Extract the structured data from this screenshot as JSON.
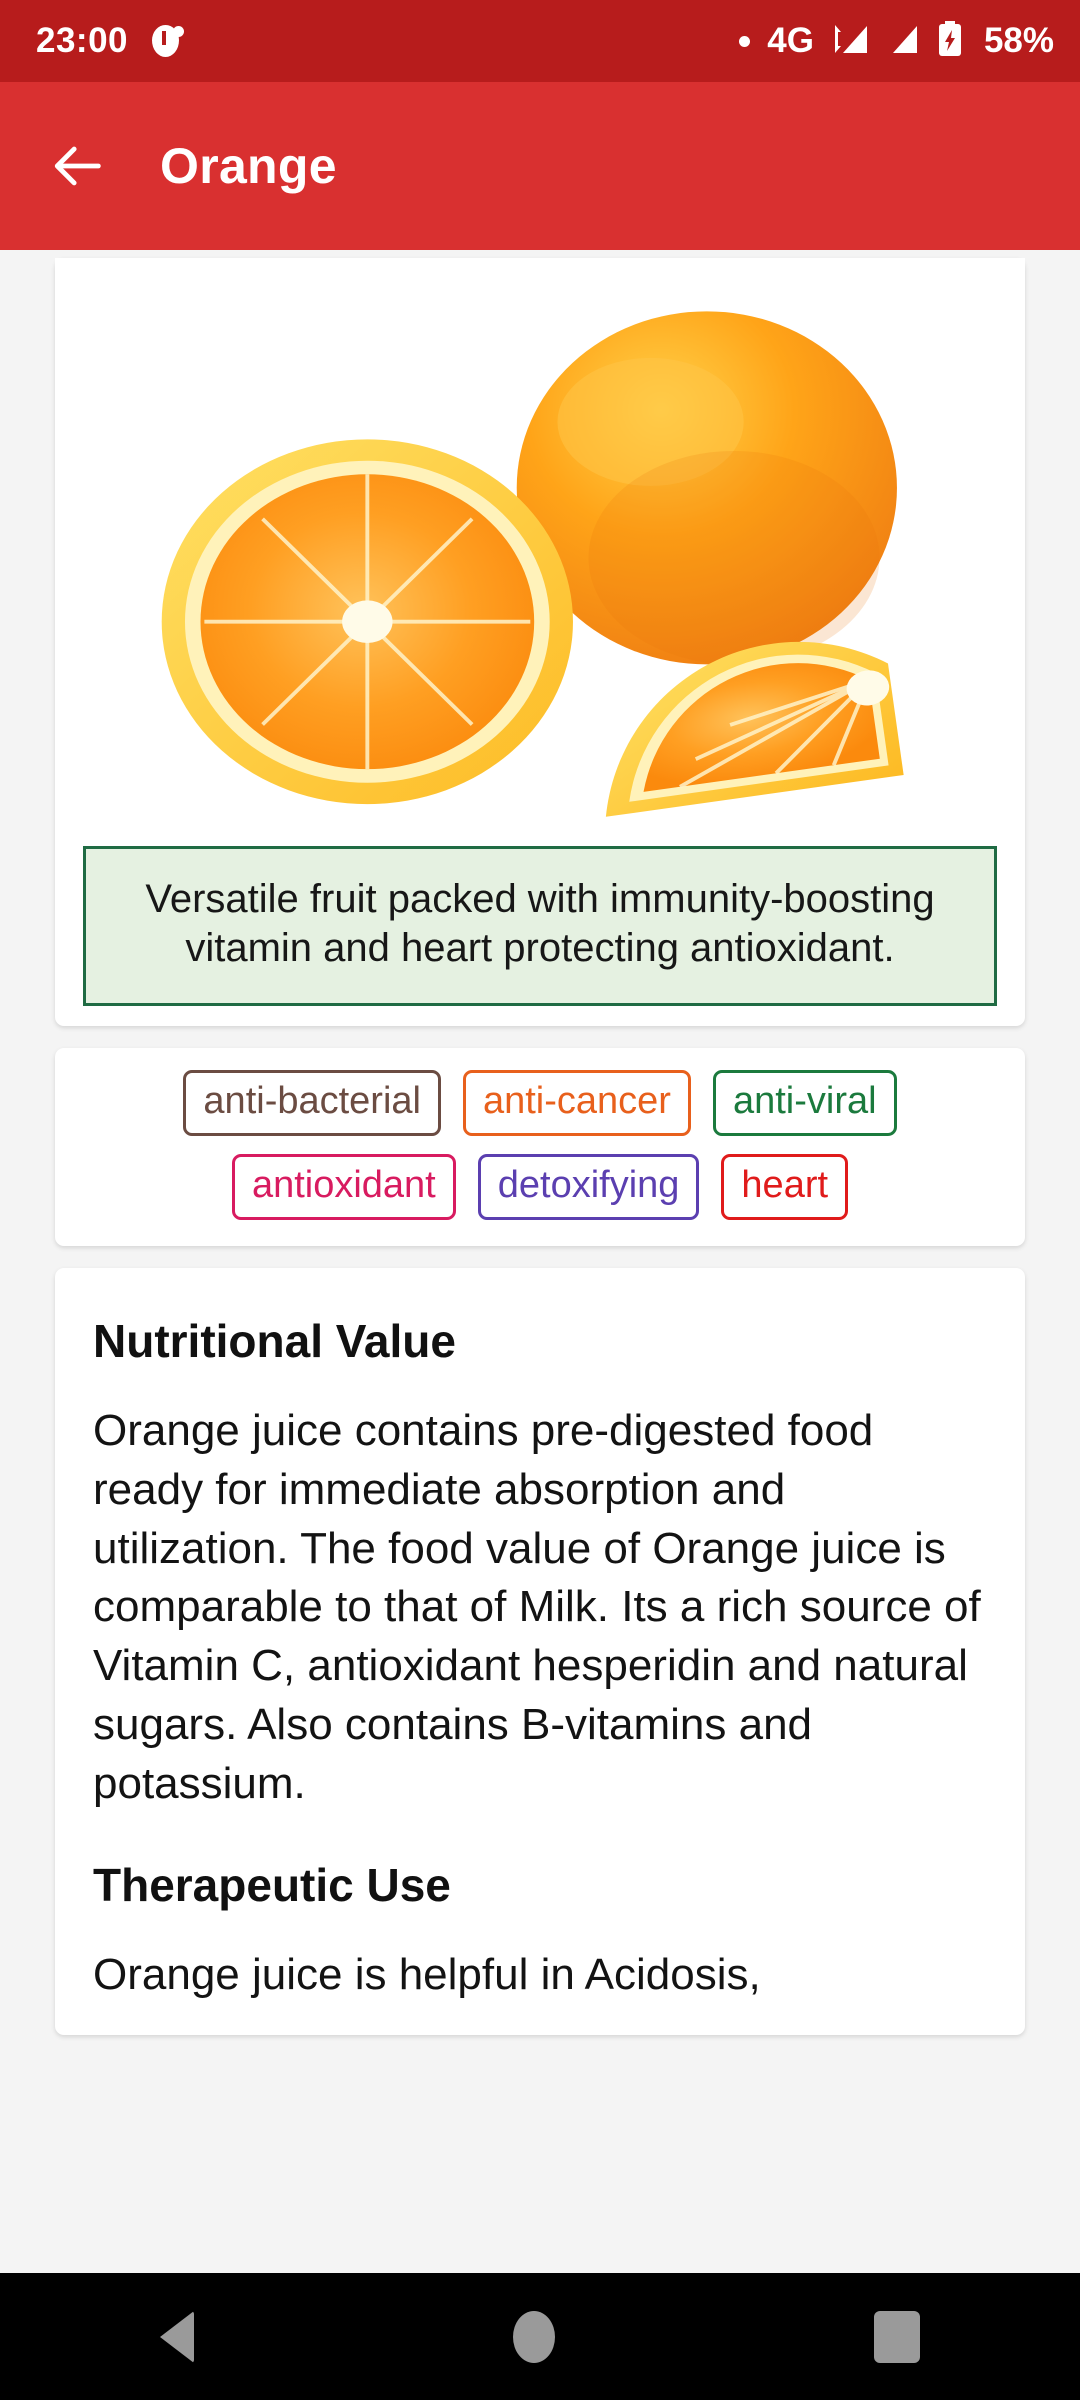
{
  "statusbar": {
    "time": "23:00",
    "alarm_icon": "alarm-clock-icon",
    "notif_dot": "notification-dot-icon",
    "network": "4G",
    "signal_one_icon": "signal-data-icon",
    "signal_two_icon": "signal-bars-icon",
    "battery_icon": "battery-charging-icon",
    "battery_percent": "58%"
  },
  "appbar": {
    "back_icon": "back-arrow-icon",
    "title": "Orange"
  },
  "hero": {
    "image_alt": "orange-fruit-photo",
    "description": "Versatile fruit packed with immunity-boosting vitamin and heart protecting antioxidant."
  },
  "tags": {
    "rows": [
      [
        {
          "label": "anti-bacterial",
          "color": "#6b4c42"
        },
        {
          "label": "anti-cancer",
          "color": "#e8601c"
        },
        {
          "label": "anti-viral",
          "color": "#1b7a3d"
        }
      ],
      [
        {
          "label": "antioxidant",
          "color": "#d81b60"
        },
        {
          "label": "detoxifying",
          "color": "#5b3fb0"
        },
        {
          "label": "heart",
          "color": "#e01b1b"
        }
      ]
    ]
  },
  "sections": [
    {
      "heading": "Nutritional Value",
      "body": "Orange juice contains pre-digested food ready for immediate absorption and utilization. The food value of Orange juice is comparable to that of Milk. Its a rich source of Vitamin C, antioxidant hesperidin and natural sugars. Also contains B-vitamins and potassium."
    },
    {
      "heading": "Therapeutic Use",
      "body": "Orange juice is helpful in Acidosis,"
    }
  ],
  "navbar": {
    "back_icon": "nav-back-triangle-icon",
    "home_icon": "nav-home-circle-icon",
    "recents_icon": "nav-recents-square-icon"
  },
  "colors": {
    "statusbar_red": "#b71c1c",
    "appbar_red": "#d93030",
    "page_bg": "#f4f4f4",
    "desc_bg": "#e5f1e1",
    "desc_border": "#1f6b43"
  }
}
